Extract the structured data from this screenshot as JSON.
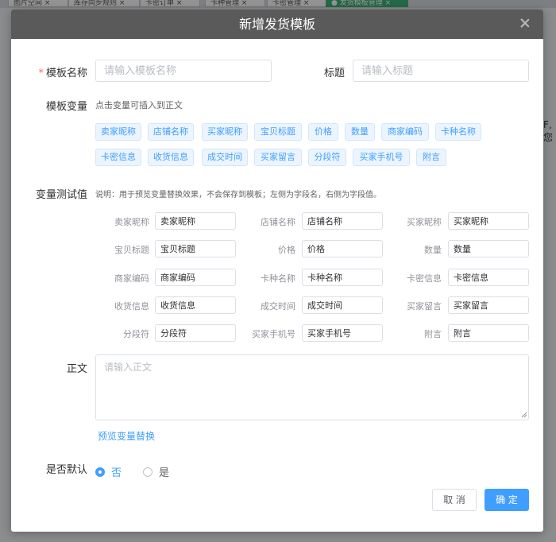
{
  "background": {
    "tabs": [
      "图片空间 ×",
      "库存同步规则 ×",
      "卡密订单 ×",
      "卡种管理 ×",
      "卡密管理 ×",
      "● 发货模板管理 ×"
    ],
    "side_text": "F,您"
  },
  "dialog": {
    "title": "新增发货模板",
    "form": {
      "template_name_label": "模板名称",
      "template_name_placeholder": "请输入模板名称",
      "title_label": "标题",
      "title_placeholder": "请输入标题",
      "variables_label": "模板变量",
      "variables_hint": "点击变量可插入到正文",
      "variable_tags": [
        "卖家昵称",
        "店铺名称",
        "买家昵称",
        "宝贝标题",
        "价格",
        "数量",
        "商家编码",
        "卡种名称",
        "卡密信息",
        "收货信息",
        "成交时间",
        "买家留言",
        "分段符",
        "买家手机号",
        "附言"
      ],
      "test_label": "变量测试值",
      "test_note": "说明：用于预览变量替换效果，不会保存到模板；左侧为字段名，右侧为字段值。",
      "test_values": [
        {
          "name": "卖家昵称",
          "value": "卖家昵称"
        },
        {
          "name": "店铺名称",
          "value": "店铺名称"
        },
        {
          "name": "买家昵称",
          "value": "买家昵称"
        },
        {
          "name": "宝贝标题",
          "value": "宝贝标题"
        },
        {
          "name": "价格",
          "value": "价格"
        },
        {
          "name": "数量",
          "value": "数量"
        },
        {
          "name": "商家编码",
          "value": "商家编码"
        },
        {
          "name": "卡种名称",
          "value": "卡种名称"
        },
        {
          "name": "卡密信息",
          "value": "卡密信息"
        },
        {
          "name": "收货信息",
          "value": "收货信息"
        },
        {
          "name": "成交时间",
          "value": "成交时间"
        },
        {
          "name": "买家留言",
          "value": "买家留言"
        },
        {
          "name": "分段符",
          "value": "分段符"
        },
        {
          "name": "买家手机号",
          "value": "买家手机号"
        },
        {
          "name": "附言",
          "value": "附言"
        }
      ],
      "body_label": "正文",
      "body_placeholder": "请输入正文",
      "preview_link": "预览变量替换",
      "default_label": "是否默认",
      "default_options": [
        {
          "label": "否",
          "selected": true
        },
        {
          "label": "是",
          "selected": false
        }
      ]
    },
    "buttons": {
      "cancel": "取 消",
      "confirm": "确 定"
    }
  },
  "colors": {
    "primary": "#409eff",
    "header": "#5a5a5a",
    "required": "#f56c6c",
    "tag_bg": "#ecf5ff"
  }
}
